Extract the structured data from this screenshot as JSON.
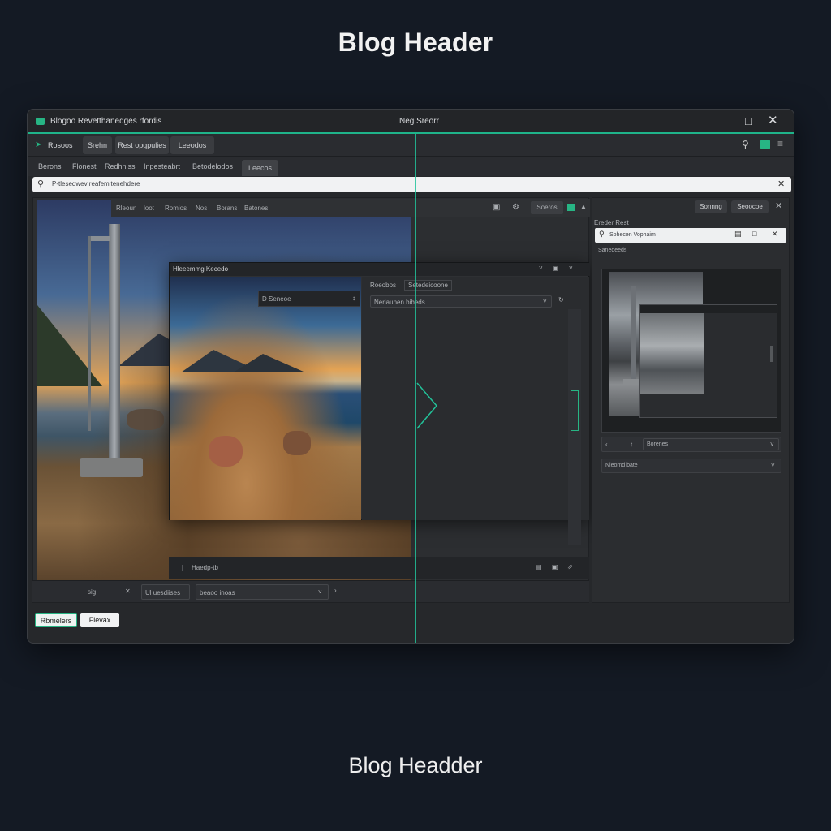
{
  "page": {
    "top_title": "Blog Header",
    "bottom_title": "Blog Headder"
  },
  "window": {
    "app_title": "Blogoo Revetthanedges rfordis",
    "center_title": "Neg Sreorr",
    "toolbar": [
      "Rosoos",
      "Srehn",
      "Rest opgpulies",
      "Leeodos"
    ],
    "tabs": [
      "Berons",
      "Flonest",
      "Redhniss",
      "Inpesteabrt",
      "Betodelodos",
      "Leecos"
    ],
    "search_text": "P-tlesedwev reafemitenehdere",
    "photo_bar": [
      "Rleoun",
      "loot",
      "Romios",
      "Nos",
      "Borans",
      "Batones"
    ],
    "photo_bar_btn": "Soeros",
    "dialog": {
      "title": "Hleeemmg Kecedo",
      "popup": "D Seneoe",
      "side_tabs": [
        "Roeobos",
        "Setedeicoone"
      ],
      "combo": "Neriaunen bibeds",
      "bottom": "Haedp-tb"
    },
    "bottom_bar": [
      "sig",
      "Ul uesdiises",
      "beaoo inoas"
    ],
    "footer_buttons": [
      "Rbmelers",
      "Flevax"
    ],
    "right_panel": {
      "buttons": [
        "Sonnng",
        "Seoocoe"
      ],
      "heading": "Ereder Rest",
      "search": "Sohecen Vophaim",
      "sub": "Sanedeeds",
      "combo1": "Borenes",
      "combo2": "Nieomd bate"
    }
  },
  "colors": {
    "background": "#141a24",
    "accent": "#22c39a"
  }
}
